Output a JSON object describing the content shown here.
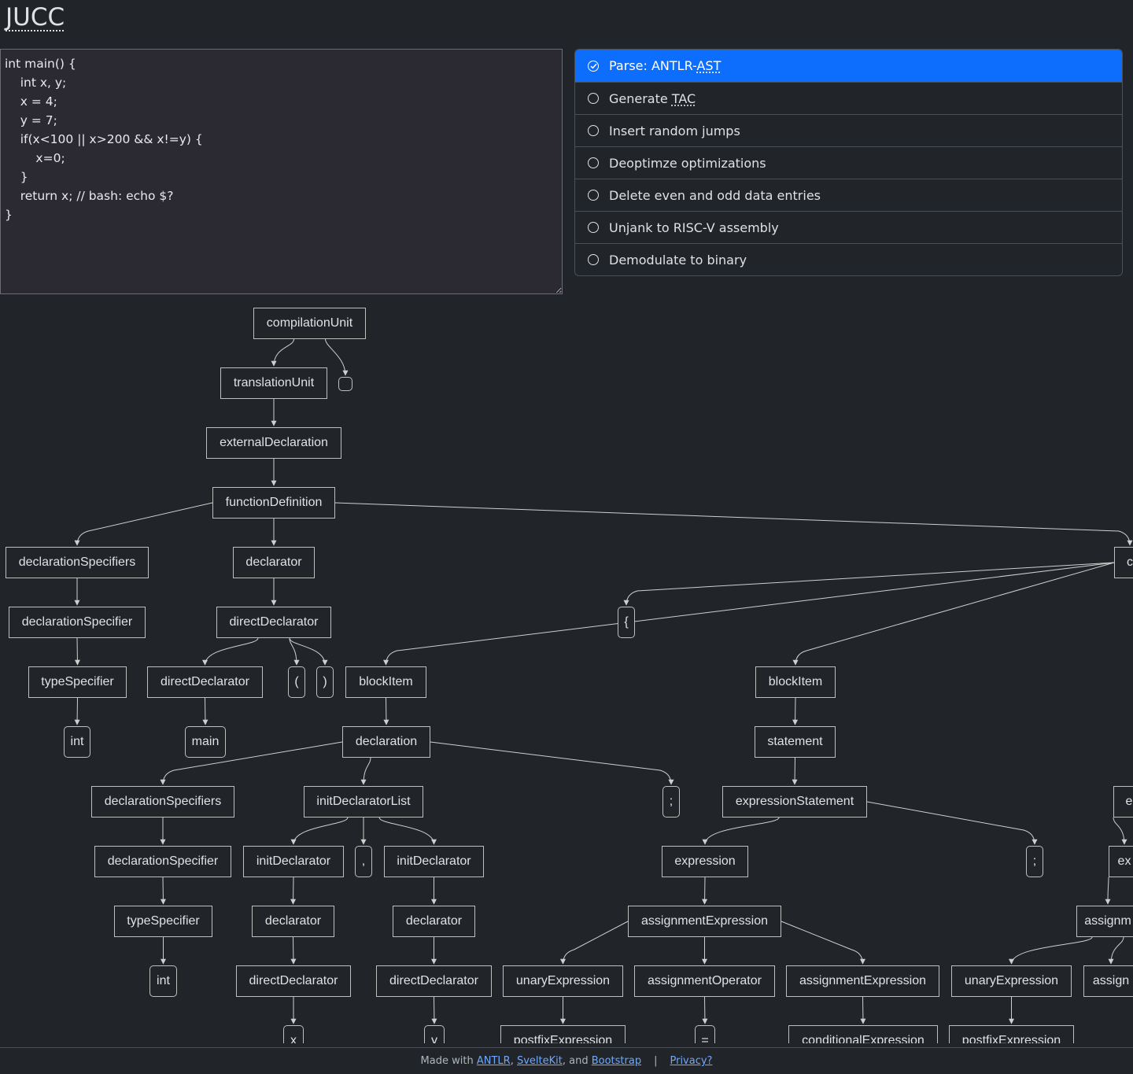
{
  "app": {
    "title": "JUCC"
  },
  "editor": {
    "code": "int main() {\n    int x, y;\n    x = 4;\n    y = 7;\n    if(x<100 || x>200 && x!=y) {\n        x=0;\n    }\n    return x; // bash: echo $?\n}"
  },
  "steps": [
    {
      "pre": "Parse: ANTLR-",
      "abbr": "AST",
      "post": "",
      "active": true
    },
    {
      "pre": "Generate ",
      "abbr": "TAC",
      "post": "",
      "active": false
    },
    {
      "pre": "Insert random jumps",
      "abbr": "",
      "post": "",
      "active": false
    },
    {
      "pre": "Deoptimze optimizations",
      "abbr": "",
      "post": "",
      "active": false
    },
    {
      "pre": "Delete even and odd data entries",
      "abbr": "",
      "post": "",
      "active": false
    },
    {
      "pre": "Unjank to RISC-V assembly",
      "abbr": "",
      "post": "",
      "active": false
    },
    {
      "pre": "Demodulate to binary",
      "abbr": "",
      "post": "",
      "active": false
    }
  ],
  "tree": {
    "nodes": [
      {
        "id": "n1",
        "label": "compilationUnit"
      },
      {
        "id": "n2",
        "label": "translationUnit"
      },
      {
        "id": "n3",
        "label": ""
      },
      {
        "id": "n4",
        "label": "externalDeclaration"
      },
      {
        "id": "n5",
        "label": "functionDefinition"
      },
      {
        "id": "n6",
        "label": "declarationSpecifiers"
      },
      {
        "id": "n7",
        "label": "declarator"
      },
      {
        "id": "n8",
        "label": "c"
      },
      {
        "id": "n9",
        "label": "declarationSpecifier"
      },
      {
        "id": "n10",
        "label": "directDeclarator"
      },
      {
        "id": "n11",
        "label": "{"
      },
      {
        "id": "n12",
        "label": "typeSpecifier"
      },
      {
        "id": "n13",
        "label": "directDeclarator"
      },
      {
        "id": "n14",
        "label": "("
      },
      {
        "id": "n15",
        "label": ")"
      },
      {
        "id": "n16",
        "label": "blockItem"
      },
      {
        "id": "n17",
        "label": "blockItem"
      },
      {
        "id": "n18",
        "label": "int"
      },
      {
        "id": "n19",
        "label": "main"
      },
      {
        "id": "n20",
        "label": "declaration"
      },
      {
        "id": "n21",
        "label": "statement"
      },
      {
        "id": "n22",
        "label": "declarationSpecifiers"
      },
      {
        "id": "n23",
        "label": "initDeclaratorList"
      },
      {
        "id": "n24",
        "label": ";"
      },
      {
        "id": "n25",
        "label": "expressionStatement"
      },
      {
        "id": "n26",
        "label": "e"
      },
      {
        "id": "n27",
        "label": "declarationSpecifier"
      },
      {
        "id": "n28",
        "label": "initDeclarator"
      },
      {
        "id": "n29",
        "label": ","
      },
      {
        "id": "n30",
        "label": "initDeclarator"
      },
      {
        "id": "n31",
        "label": "expression"
      },
      {
        "id": "n32",
        "label": ";"
      },
      {
        "id": "n33",
        "label": "ex"
      },
      {
        "id": "n34",
        "label": "typeSpecifier"
      },
      {
        "id": "n35",
        "label": "declarator"
      },
      {
        "id": "n36",
        "label": "declarator"
      },
      {
        "id": "n37",
        "label": "assignmentExpression"
      },
      {
        "id": "n38",
        "label": "assignm"
      },
      {
        "id": "n39",
        "label": "int"
      },
      {
        "id": "n40",
        "label": "directDeclarator"
      },
      {
        "id": "n41",
        "label": "directDeclarator"
      },
      {
        "id": "n42",
        "label": "unaryExpression"
      },
      {
        "id": "n43",
        "label": "assignmentOperator"
      },
      {
        "id": "n44",
        "label": "assignmentExpression"
      },
      {
        "id": "n45",
        "label": "unaryExpression"
      },
      {
        "id": "n46",
        "label": "assign"
      },
      {
        "id": "n47",
        "label": "x"
      },
      {
        "id": "n48",
        "label": "y"
      },
      {
        "id": "n49",
        "label": "postfixExpression"
      },
      {
        "id": "n50",
        "label": "="
      },
      {
        "id": "n51",
        "label": "conditionalExpression"
      },
      {
        "id": "n52",
        "label": "postfixExpression"
      }
    ]
  },
  "footer": {
    "made_with": "Made with",
    "antlr": "ANTLR",
    "comma1": ",",
    "sveltekit": "SvelteKit",
    "and": ", and",
    "bootstrap": "Bootstrap",
    "sep": "|",
    "privacy": "Privacy?"
  }
}
